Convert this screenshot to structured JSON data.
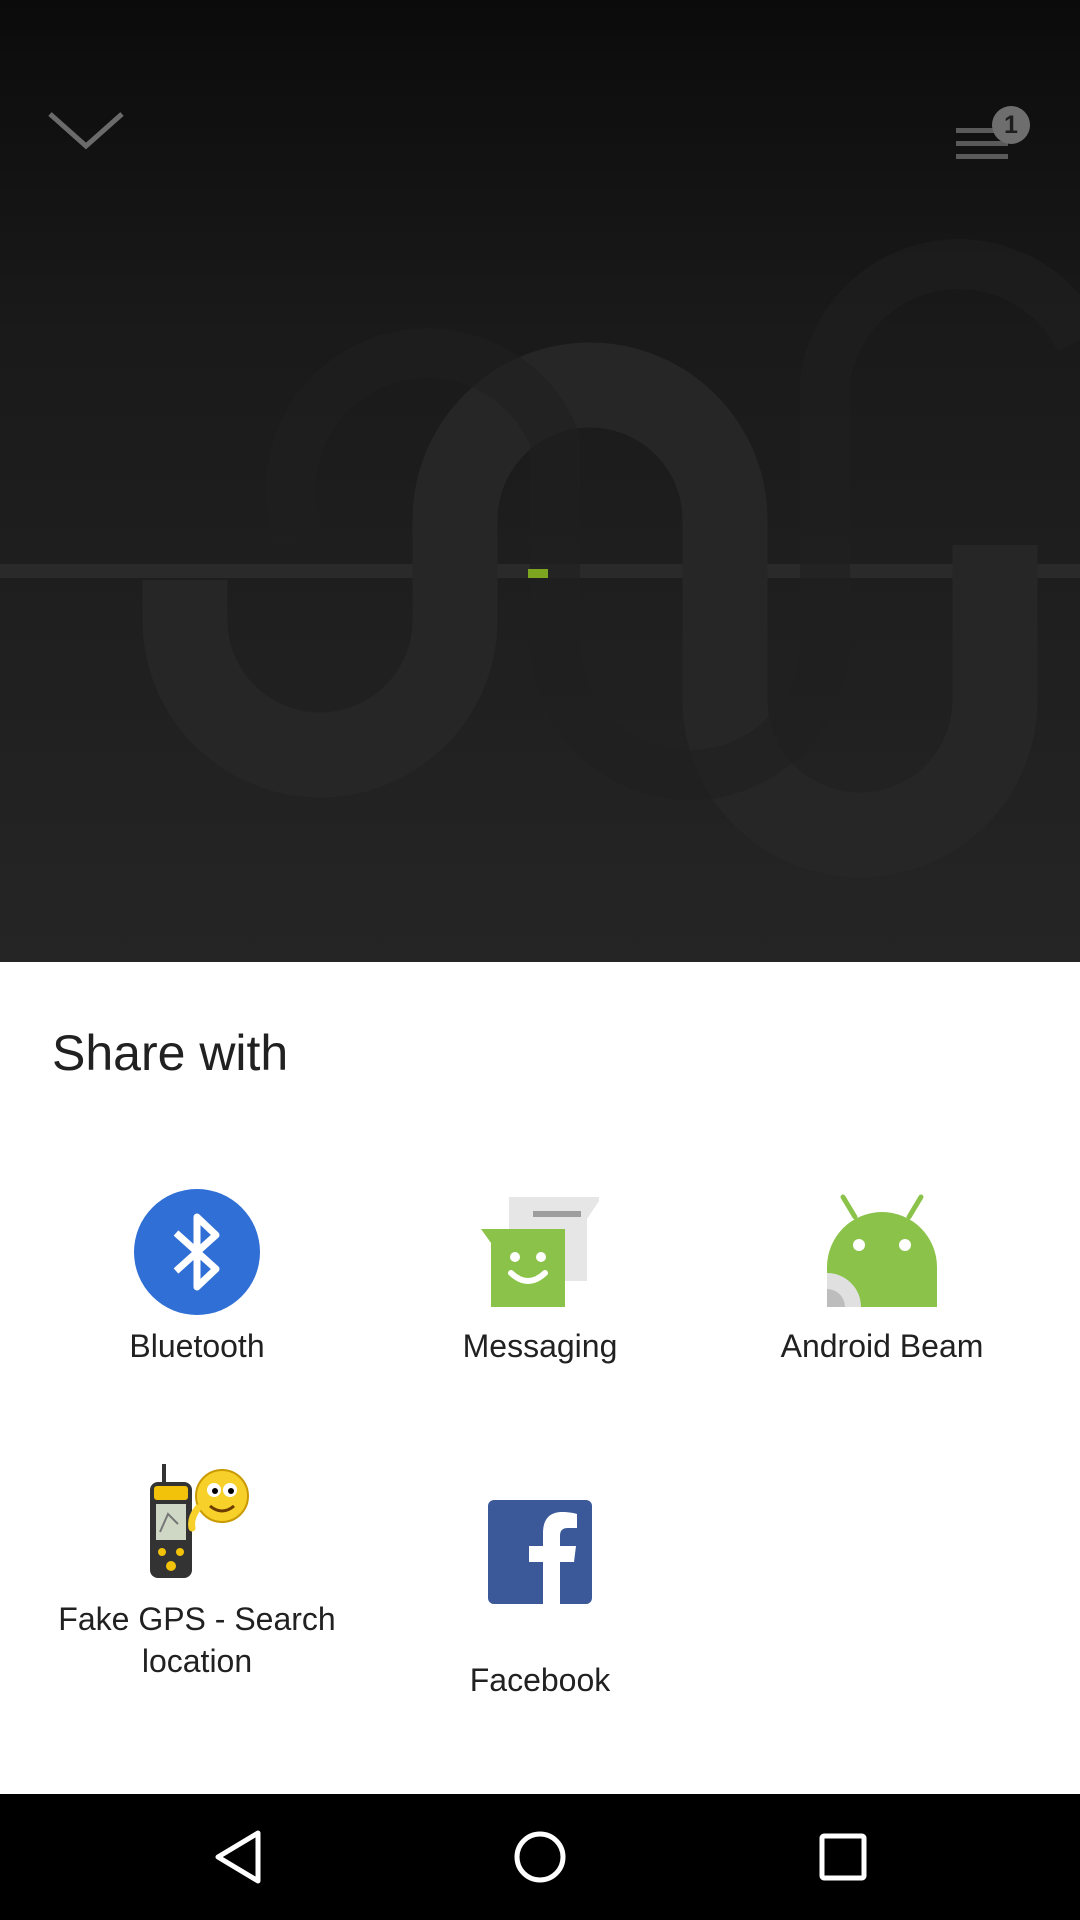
{
  "player": {
    "queue_count": "1"
  },
  "share_sheet": {
    "title": "Share with",
    "targets": [
      {
        "label": "Bluetooth",
        "icon": "bluetooth-icon"
      },
      {
        "label": "Messaging",
        "icon": "messaging-icon"
      },
      {
        "label": "Android Beam",
        "icon": "android-beam-icon"
      },
      {
        "label": "Fake GPS - Search location",
        "icon": "fake-gps-icon"
      },
      {
        "label": "Facebook",
        "icon": "facebook-icon"
      }
    ]
  },
  "nav_bar": {
    "buttons": [
      "back-icon",
      "home-icon",
      "recents-icon"
    ]
  },
  "colors": {
    "bluetooth": "#2F6FD6",
    "messaging": "#8BC34A",
    "android": "#8BC34A",
    "facebook": "#3B5998",
    "accent_dash": "#7DA620"
  }
}
